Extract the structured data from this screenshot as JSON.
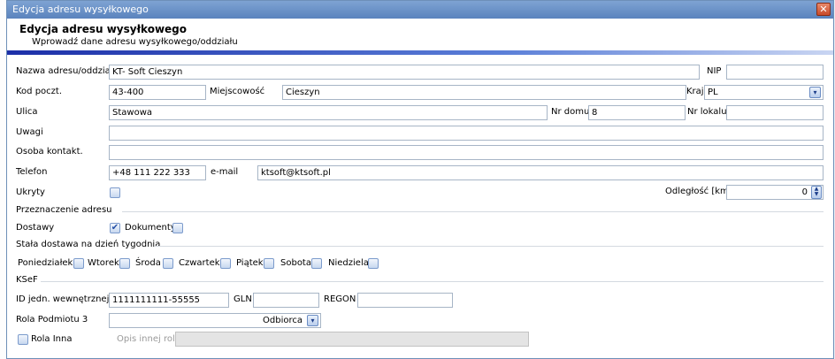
{
  "window": {
    "title": "Edycja adresu wysyłkowego",
    "close_glyph": "✕"
  },
  "header": {
    "title": "Edycja adresu wysyłkowego",
    "subtitle": "Wprowadź dane adresu wysyłkowego/oddziału"
  },
  "form": {
    "name": {
      "label": "Nazwa adresu/oddziału",
      "value": "KT- Soft Cieszyn"
    },
    "nip": {
      "label": "NIP",
      "value": ""
    },
    "postal": {
      "label": "Kod poczt.",
      "value": "43-400"
    },
    "city": {
      "label": "Miejscowość",
      "value": "Cieszyn"
    },
    "country": {
      "label": "Kraj",
      "value": "PL"
    },
    "street": {
      "label": "Ulica",
      "value": "Stawowa"
    },
    "house_no": {
      "label": "Nr domu",
      "value": "8"
    },
    "flat_no": {
      "label": "Nr lokalu",
      "value": ""
    },
    "notes": {
      "label": "Uwagi",
      "value": ""
    },
    "contact": {
      "label": "Osoba kontakt.",
      "value": ""
    },
    "phone": {
      "label": "Telefon",
      "value": "+48 111 222 333"
    },
    "email": {
      "label": "e-mail",
      "value": "ktsoft@ktsoft.pl"
    },
    "hidden": {
      "label": "Ukryty",
      "checked": false
    },
    "distance": {
      "label": "Odległość [km]",
      "value": "0"
    }
  },
  "purpose": {
    "section_label": "Przeznaczenie adresu",
    "deliveries": {
      "label": "Dostawy",
      "checked": true
    },
    "documents": {
      "label": "Dokumenty",
      "checked": false
    }
  },
  "weekday": {
    "section_label": "Stała dostawa na dzień tygodnia",
    "days": [
      {
        "label": "Poniedziałek",
        "checked": false
      },
      {
        "label": "Wtorek",
        "checked": false
      },
      {
        "label": "Środa",
        "checked": false
      },
      {
        "label": "Czwartek",
        "checked": false
      },
      {
        "label": "Piątek",
        "checked": false
      },
      {
        "label": "Sobota",
        "checked": false
      },
      {
        "label": "Niedziela",
        "checked": false
      }
    ]
  },
  "ksef": {
    "section_label": "KSeF",
    "internal_id": {
      "label": "ID jedn. wewnętrznej",
      "value": "1111111111-55555"
    },
    "gln": {
      "label": "GLN",
      "value": ""
    },
    "regon": {
      "label": "REGON",
      "value": ""
    },
    "role": {
      "label": "Rola Podmiotu 3",
      "value": "Odbiorca"
    },
    "role_other": {
      "label": "Rola Inna",
      "checked": false
    },
    "role_other_desc": {
      "placeholder": "Opis innej roli",
      "value": ""
    }
  },
  "glyphs": {
    "check": "✔",
    "dropdown": "▾",
    "spin_up": "▲",
    "spin_down": "▼"
  }
}
